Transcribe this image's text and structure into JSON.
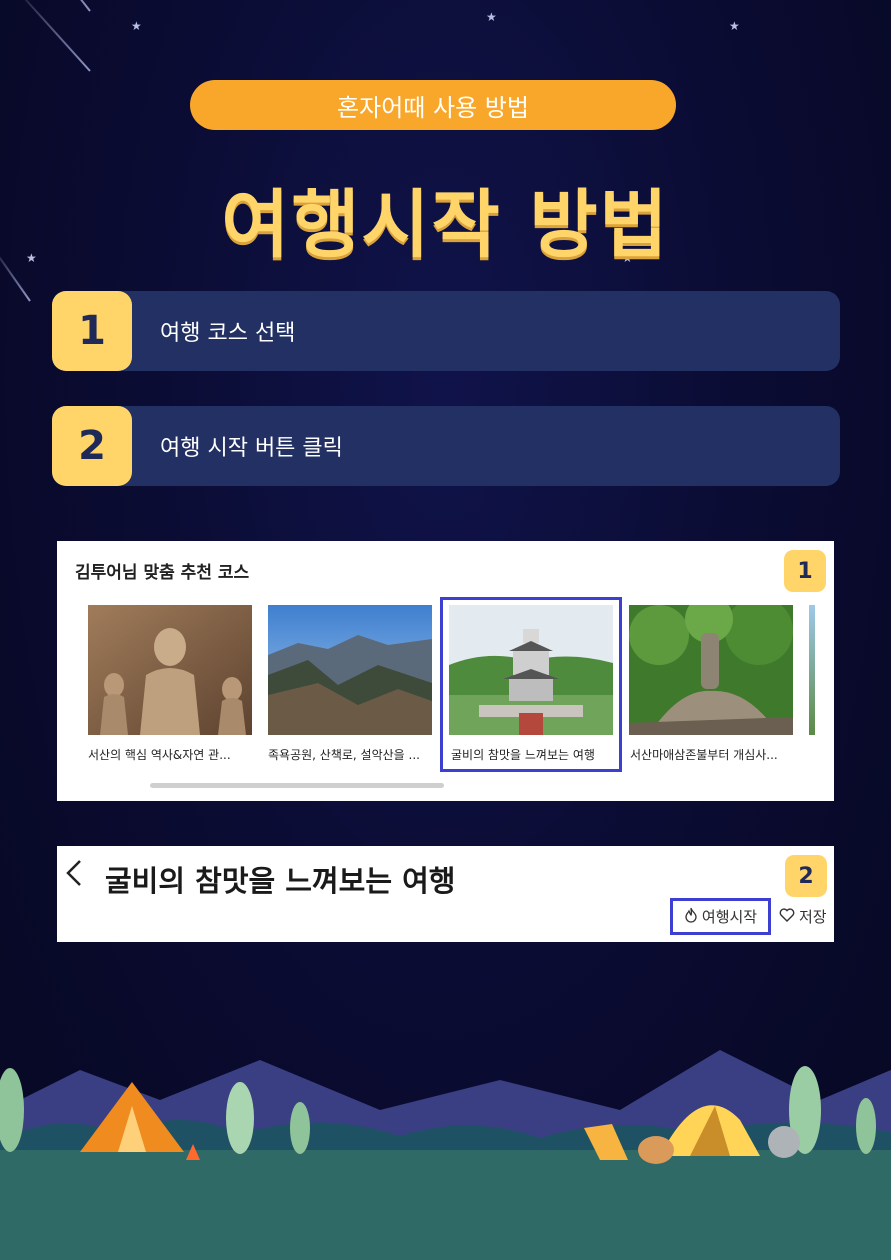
{
  "header": {
    "pill_label": "혼자어때 사용 방법",
    "title": "여행시작 방법"
  },
  "steps": [
    {
      "number": "1",
      "label": "여행 코스 선택"
    },
    {
      "number": "2",
      "label": "여행 시작 버튼 클릭"
    }
  ],
  "course_panel": {
    "title": "김투어님 맞춤 추천 코스",
    "badge": "1",
    "courses": [
      {
        "caption": "서산의 핵심 역사&자연 관..."
      },
      {
        "caption": "족욕공원, 산책로, 설악산을 ..."
      },
      {
        "caption": "굴비의 참맛을 느껴보는 여행"
      },
      {
        "caption": "서산마애삼존불부터 개심사..."
      }
    ],
    "selected_index": 2
  },
  "detail_panel": {
    "back_icon": "chevron-left-icon",
    "title": "굴비의 참맛을 느껴보는 여행",
    "badge": "2",
    "start_label": "여행시작",
    "start_icon": "flame-icon",
    "save_label": "저장",
    "save_icon": "heart-icon"
  },
  "colors": {
    "background": "#0a0b2e",
    "pill": "#f9a72a",
    "title": "#ffd56a",
    "step_bar": "#223064",
    "badge": "#ffd56a",
    "highlight": "#3d3fd1"
  }
}
